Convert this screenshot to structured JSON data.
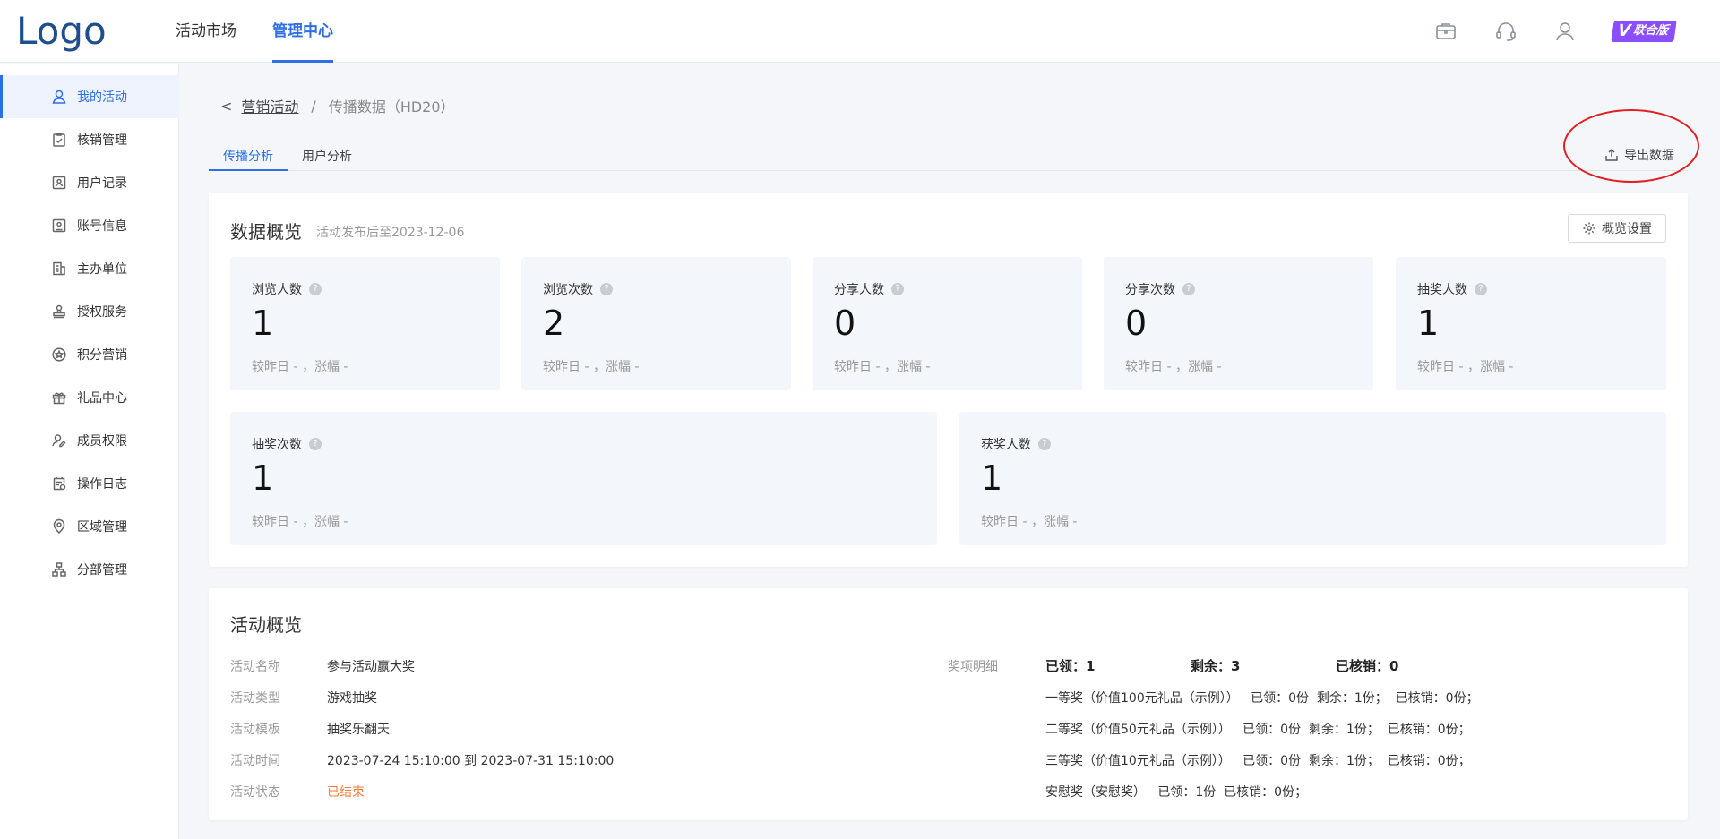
{
  "header": {
    "logo": "Logo",
    "nav": [
      "活动市场",
      "管理中心"
    ],
    "edition_badge": "联合版",
    "badge_mark": "V"
  },
  "sidebar": {
    "items": [
      {
        "label": "我的活动",
        "icon": "user-icon"
      },
      {
        "label": "核销管理",
        "icon": "clipboard-check-icon"
      },
      {
        "label": "用户记录",
        "icon": "user-record-icon"
      },
      {
        "label": "账号信息",
        "icon": "account-card-icon"
      },
      {
        "label": "主办单位",
        "icon": "building-icon"
      },
      {
        "label": "授权服务",
        "icon": "stamp-icon"
      },
      {
        "label": "积分营销",
        "icon": "star-circle-icon"
      },
      {
        "label": "礼品中心",
        "icon": "gift-icon"
      },
      {
        "label": "成员权限",
        "icon": "user-key-icon"
      },
      {
        "label": "操作日志",
        "icon": "log-icon"
      },
      {
        "label": "区域管理",
        "icon": "location-icon"
      },
      {
        "label": "分部管理",
        "icon": "org-tree-icon"
      }
    ]
  },
  "breadcrumb": {
    "back": "<",
    "parent": "营销活动",
    "separator": "/",
    "current": "传播数据（HD20）"
  },
  "tabs": [
    "传播分析",
    "用户分析"
  ],
  "export_label": "导出数据",
  "overview": {
    "title": "数据概览",
    "subtitle": "活动发布后至2023-12-06",
    "settings_label": "概览设置",
    "stats": [
      {
        "label": "浏览人数",
        "value": "1",
        "compare": "较昨日 - ，涨幅 -"
      },
      {
        "label": "浏览次数",
        "value": "2",
        "compare": "较昨日 - ，涨幅 -"
      },
      {
        "label": "分享人数",
        "value": "0",
        "compare": "较昨日 - ，涨幅 -"
      },
      {
        "label": "分享次数",
        "value": "0",
        "compare": "较昨日 - ，涨幅 -"
      },
      {
        "label": "抽奖人数",
        "value": "1",
        "compare": "较昨日 - ，涨幅 -"
      },
      {
        "label": "抽奖次数",
        "value": "1",
        "compare": "较昨日 - ，涨幅 -"
      },
      {
        "label": "获奖人数",
        "value": "1",
        "compare": "较昨日 - ，涨幅 -"
      }
    ],
    "help_mark": "?"
  },
  "activity": {
    "title": "活动概览",
    "fields": [
      {
        "label": "活动名称",
        "value": "参与活动赢大奖"
      },
      {
        "label": "活动类型",
        "value": "游戏抽奖"
      },
      {
        "label": "活动模板",
        "value": "抽奖乐翻天"
      },
      {
        "label": "活动时间",
        "value": "2023-07-24 15:10:00 到 2023-07-31 15:10:00"
      },
      {
        "label": "活动状态",
        "value": "已结束"
      }
    ],
    "prize_label": "奖项明细",
    "prize_summary": [
      "已领：1",
      "剩余：3",
      "已核销：0"
    ],
    "prizes": [
      "一等奖（价值100元礼品（示例））   已领：0份  剩余：1份；  已核销：0份；",
      "二等奖（价值50元礼品（示例））   已领：0份  剩余：1份；  已核销：0份；",
      "三等奖（价值10元礼品（示例））   已领：0份  剩余：1份；  已核销：0份；",
      "安慰奖（安慰奖）   已领：1份  已核销：0份；"
    ]
  },
  "colors": {
    "accent": "#2f6fe4",
    "ended": "#f07a3b",
    "annotation": "#e02020",
    "badge": "#8a4dff"
  }
}
